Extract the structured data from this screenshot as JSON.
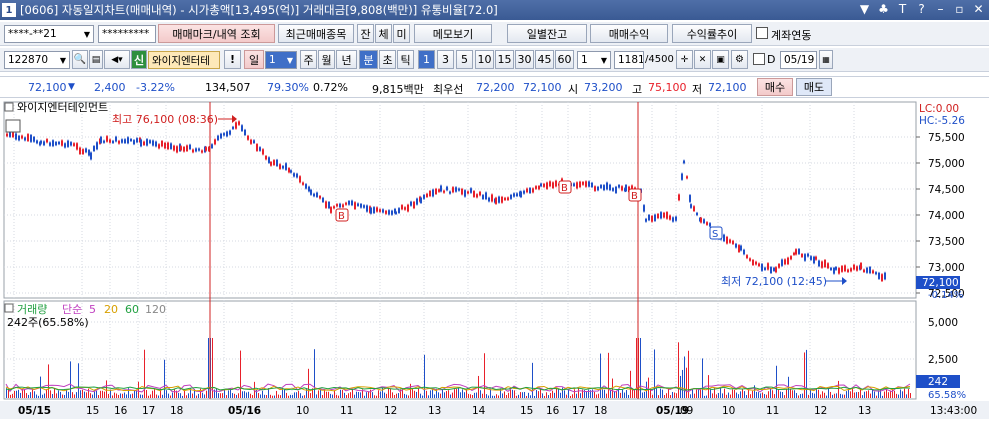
{
  "title": {
    "window_number": "1",
    "text": "[0606] 자동일지차트(매매내역) - 시가총액[13,495(억)] 거래대금[9,808(백만)] 유통비율[72.0]",
    "controls": [
      "▼",
      "♣",
      "T",
      "?",
      "–",
      "▫",
      "✕"
    ]
  },
  "toolbar1": {
    "account": "****-**21",
    "password": "*********",
    "buttons": [
      "매매마크/내역 조회",
      "최근매매종목",
      "잔",
      "체",
      "미",
      "메모보기",
      "일별잔고",
      "매매수익",
      "수익률추이"
    ],
    "link_label": "계좌연동"
  },
  "toolbar2": {
    "code": "122870",
    "stock_badge": "신",
    "stock_name": "와이지엔터테",
    "period_buttons": [
      "일",
      "주",
      "월",
      "년",
      "분",
      "초",
      "틱"
    ],
    "period_value": "1",
    "interval_buttons": [
      "1",
      "3",
      "5",
      "10",
      "15",
      "30",
      "45",
      "60"
    ],
    "count_select": "1",
    "bars_count": "1181",
    "bars_total": "/4500",
    "date_flag": "D",
    "date": "05/19"
  },
  "quote": {
    "price": "72,100",
    "change": "2,400",
    "change_pct": "-3.22%",
    "volume": "134,507",
    "pct1": "79.30%",
    "pct2": "0.72%",
    "amount": "9,815백만",
    "best_label": "최우선",
    "best_ask": "72,200",
    "best_bid": "72,100",
    "open_label": "시",
    "open": "73,200",
    "high_label": "고",
    "high": "75,100",
    "low_label": "저",
    "low": "72,100",
    "buy_label": "매수",
    "sell_label": "매도"
  },
  "chart": {
    "stock_label": "와이지엔터테인먼트",
    "max_note": "최고 76,100 (08:36)",
    "min_note": "최저 72,100 (12:45)",
    "lc": "LC:0.00",
    "hc": "HC:-5.26",
    "price_ticks": [
      "75,500",
      "75,000",
      "74,500",
      "74,000",
      "73,500",
      "73,000",
      "72,500"
    ],
    "current_price_tag": "72,100",
    "current_pct": "-0.14%",
    "volume_legend": {
      "name": "거래량",
      "type": "단순",
      "ma": [
        "5",
        "20",
        "60",
        "120"
      ]
    },
    "volume_now": "242주(65.58%)",
    "volume_ticks": [
      "5,000",
      "2,500"
    ],
    "volume_tag": "242",
    "volume_pct": "65.58%",
    "x_labels": [
      "05/15",
      "15",
      "16",
      "17",
      "18",
      "05/16",
      "10",
      "11",
      "12",
      "13",
      "14",
      "15",
      "16",
      "17",
      "18",
      "05/19",
      "09",
      "10",
      "11",
      "12",
      "13"
    ],
    "time": "13:43:00"
  },
  "colors": {
    "up": "#e8202a",
    "down": "#1e4fc8",
    "title": "#3a5a94",
    "ma5": "#c040c0",
    "ma20": "#d8a000",
    "ma60": "#20a040"
  }
}
